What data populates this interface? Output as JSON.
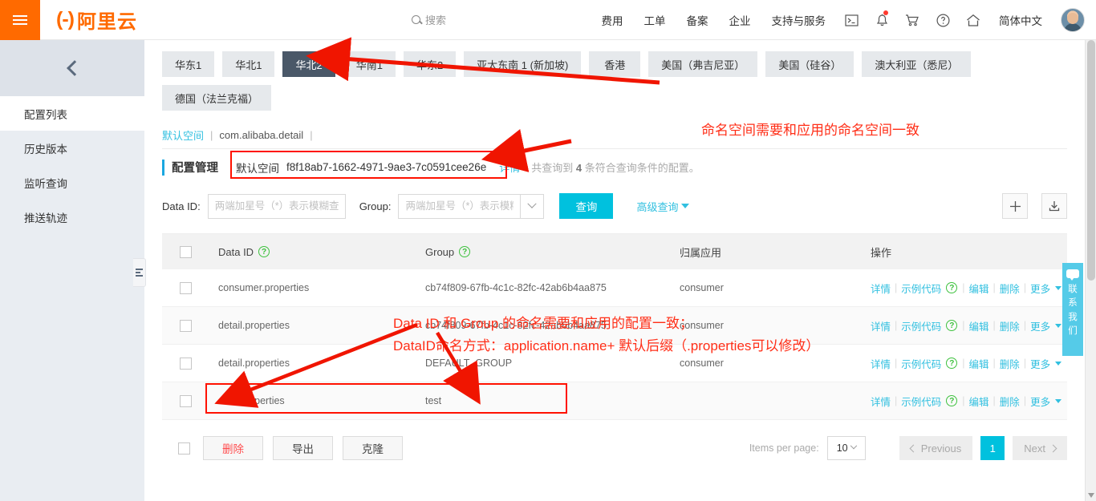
{
  "header": {
    "logo_text": "阿里云",
    "logo_mark": "(-)",
    "search_placeholder": "搜索",
    "nav": [
      {
        "label": "费用"
      },
      {
        "label": "工单"
      },
      {
        "label": "备案"
      },
      {
        "label": "企业"
      },
      {
        "label": "支持与服务"
      }
    ],
    "icons": [
      "console-icon",
      "bell-icon",
      "cart-icon",
      "help-icon",
      "home-icon"
    ],
    "language": "简体中文"
  },
  "sidebar": {
    "collapse_icon": "chevron-left-icon",
    "items": [
      {
        "label": "配置列表",
        "active": true
      },
      {
        "label": "历史版本",
        "active": false
      },
      {
        "label": "监听查询",
        "active": false
      },
      {
        "label": "推送轨迹",
        "active": false
      }
    ]
  },
  "regions": {
    "tabs": [
      {
        "label": "华东1",
        "active": false
      },
      {
        "label": "华北1",
        "active": false
      },
      {
        "label": "华北2",
        "active": true
      },
      {
        "label": "华南1",
        "active": false
      },
      {
        "label": "华东2",
        "active": false
      },
      {
        "label": "亚太东南 1 (新加坡)",
        "active": false
      },
      {
        "label": "香港",
        "active": false
      },
      {
        "label": "美国（弗吉尼亚）",
        "active": false
      },
      {
        "label": "美国（硅谷）",
        "active": false
      },
      {
        "label": "澳大利亚（悉尼）",
        "active": false
      },
      {
        "label": "德国（法兰克福）",
        "active": false
      }
    ]
  },
  "breadcrumb": {
    "link": "默认空间",
    "sep1": "|",
    "text": "com.alibaba.detail",
    "sep2": "|"
  },
  "namespace": {
    "title": "配置管理",
    "name": "默认空间",
    "id": "f8f18ab7-1662-4971-9ae3-7c0591cee26e",
    "detail_link": "详情",
    "count_prefix": "共查询到",
    "count": "4",
    "count_suffix": "条符合查询条件的配置。"
  },
  "filters": {
    "data_id_label": "Data ID:",
    "data_id_placeholder": "两端加星号（*）表示模糊查询",
    "data_id_value": "",
    "group_label": "Group:",
    "group_placeholder": "两端加星号（*）表示模糊查询",
    "group_value": "",
    "query_button": "查询",
    "advanced_query": "高级查询",
    "add_button_icon": "plus-icon",
    "export_button_icon": "download-icon"
  },
  "table": {
    "columns": [
      "Data ID",
      "Group",
      "归属应用",
      "操作"
    ],
    "rows": [
      {
        "data_id": "consumer.properties",
        "group": "cb74f809-67fb-4c1c-82fc-42ab6b4aa875",
        "app": "consumer"
      },
      {
        "data_id": "detail.properties",
        "group": "cb74f809-67fb-4c1c-82fc-42ab6b4aa875",
        "app": "consumer"
      },
      {
        "data_id": "detail.properties",
        "group": "DEFAULT_GROUP",
        "app": "consumer"
      },
      {
        "data_id": "acm.properties",
        "group": "test",
        "app": ""
      }
    ],
    "ops": {
      "detail": "详情",
      "sample_code": "示例代码",
      "edit": "编辑",
      "delete": "删除",
      "more": "更多"
    }
  },
  "footer": {
    "delete_button": "删除",
    "export_button": "导出",
    "clone_button": "克隆",
    "items_per_page_label": "Items per page:",
    "items_per_page_value": "10",
    "previous": "Previous",
    "page": "1",
    "next": "Next"
  },
  "contact_widget": {
    "chars": [
      "联",
      "系",
      "我",
      "们"
    ]
  },
  "annotations": {
    "namespace_note": "命名空间需要和应用的命名空间一致",
    "table_note_line1": "Data ID 和 Group 的命名需要和应用的配置一致；",
    "table_note_line2": "DataID命名方式：application.name+ 默认后缀（.properties可以修改）"
  },
  "colors": {
    "brand_orange": "#ff6a00",
    "link_cyan": "#32c0e0",
    "button_cyan": "#00c1de",
    "active_tab": "#4a5868",
    "annotation_red": "#ff2e17",
    "danger": "#ff4d4f"
  }
}
